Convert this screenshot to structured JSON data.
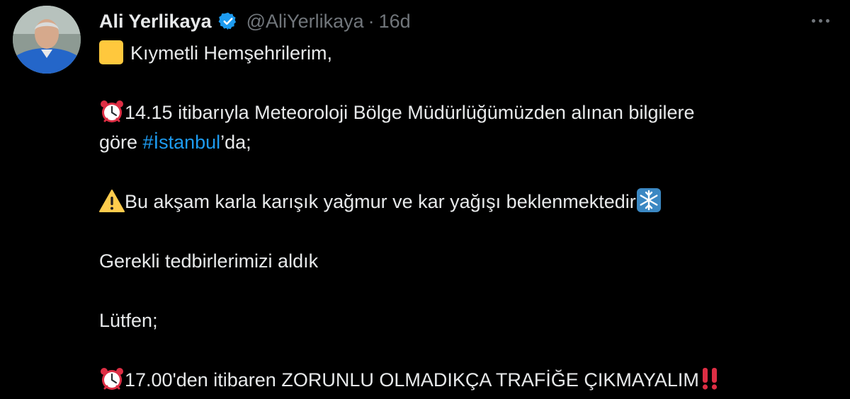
{
  "author": {
    "name": "Ali Yerlikaya",
    "handle": "@AliYerlikaya",
    "separator": "·",
    "time": "16d"
  },
  "tweet": {
    "greeting": "Kıymetli Hemşehrilerim,",
    "line1": "14.15 itibarıyla Meteoroloji Bölge Müdürlüğümüzden alınan bilgilere",
    "line2_pre": "göre ",
    "line2_hashtag": "#İstanbul",
    "line2_post": "’da;",
    "warning": "Bu akşam karla karışık yağmur ve kar yağışı beklenmektedir",
    "measures": "Gerekli tedbirlerimizi aldık",
    "please": "Lütfen;",
    "traffic": "17.00'den itibaren ZORUNLU OLMADIKÇA TRAFİĞE ÇIKMAYALIM"
  },
  "icons": {
    "verified": "verified-badge-icon",
    "more": "more-dots-icon",
    "emoji_1": "yellow-square-emoji",
    "emoji_2": "alarm-clock-emoji",
    "emoji_3": "warning-emoji",
    "emoji_4": "snowflake-emoji",
    "emoji_5": "double-exclamation-emoji"
  },
  "colors": {
    "background": "#000000",
    "text": "#e7e9ea",
    "muted": "#71767b",
    "link": "#1d9bf0",
    "verified": "#1d9bf0"
  }
}
